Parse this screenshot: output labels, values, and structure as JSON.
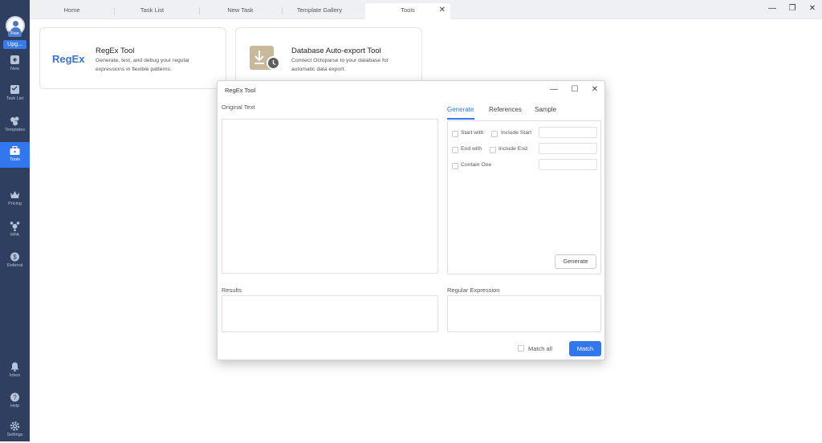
{
  "sidebar": {
    "free_badge": "Free",
    "upgrade_label": "Upg...",
    "items": [
      {
        "label": "New",
        "icon": "plus-square-icon"
      },
      {
        "label": "Task List",
        "icon": "list-icon"
      },
      {
        "label": "Templates",
        "icon": "templates-icon"
      },
      {
        "label": "Tools",
        "icon": "toolbox-icon",
        "active": true
      },
      {
        "label": "Pricing",
        "icon": "crown-icon"
      },
      {
        "label": "RPA",
        "icon": "rpa-icon"
      },
      {
        "label": "Referral",
        "icon": "dollar-icon"
      },
      {
        "label": "Inbox",
        "icon": "bell-icon"
      },
      {
        "label": "Help",
        "icon": "help-icon"
      },
      {
        "label": "Settings",
        "icon": "gear-icon"
      }
    ]
  },
  "tabs": [
    {
      "label": "Home"
    },
    {
      "label": "Task List"
    },
    {
      "label": "New Task"
    },
    {
      "label": "Template Gallery"
    },
    {
      "label": "Tools",
      "active": true
    }
  ],
  "tab_close": "✕",
  "window_controls": {
    "minimize": "—",
    "restore": "❐",
    "close": "✕"
  },
  "cards": {
    "regex": {
      "logo": "RegEx",
      "title": "RegEx Tool",
      "desc": "Generate, test, and debug your regular expressions in flexible patterns."
    },
    "db": {
      "title": "Database Auto-export Tool",
      "desc": "Connect Octoparse to your database for automatic data export."
    }
  },
  "dialog": {
    "title": "RegEx Tool",
    "controls": {
      "minimize": "—",
      "maximize": "☐",
      "close": "✕"
    },
    "original_text_label": "Original Text",
    "results_label": "Results",
    "regex_label": "Regular Expression",
    "tabs": {
      "generate": "Generate",
      "references": "References",
      "sample": "Sample"
    },
    "options": {
      "start_with": "Start with",
      "include_start": "Include Start",
      "end_with": "End with",
      "include_end": "Include End",
      "contain_one": "Contain One"
    },
    "generate_button": "Generate",
    "match_all_label": "Match all",
    "match_button": "Match"
  },
  "colors": {
    "accent": "#3377ee",
    "sidebar": "#2e3f5f"
  }
}
